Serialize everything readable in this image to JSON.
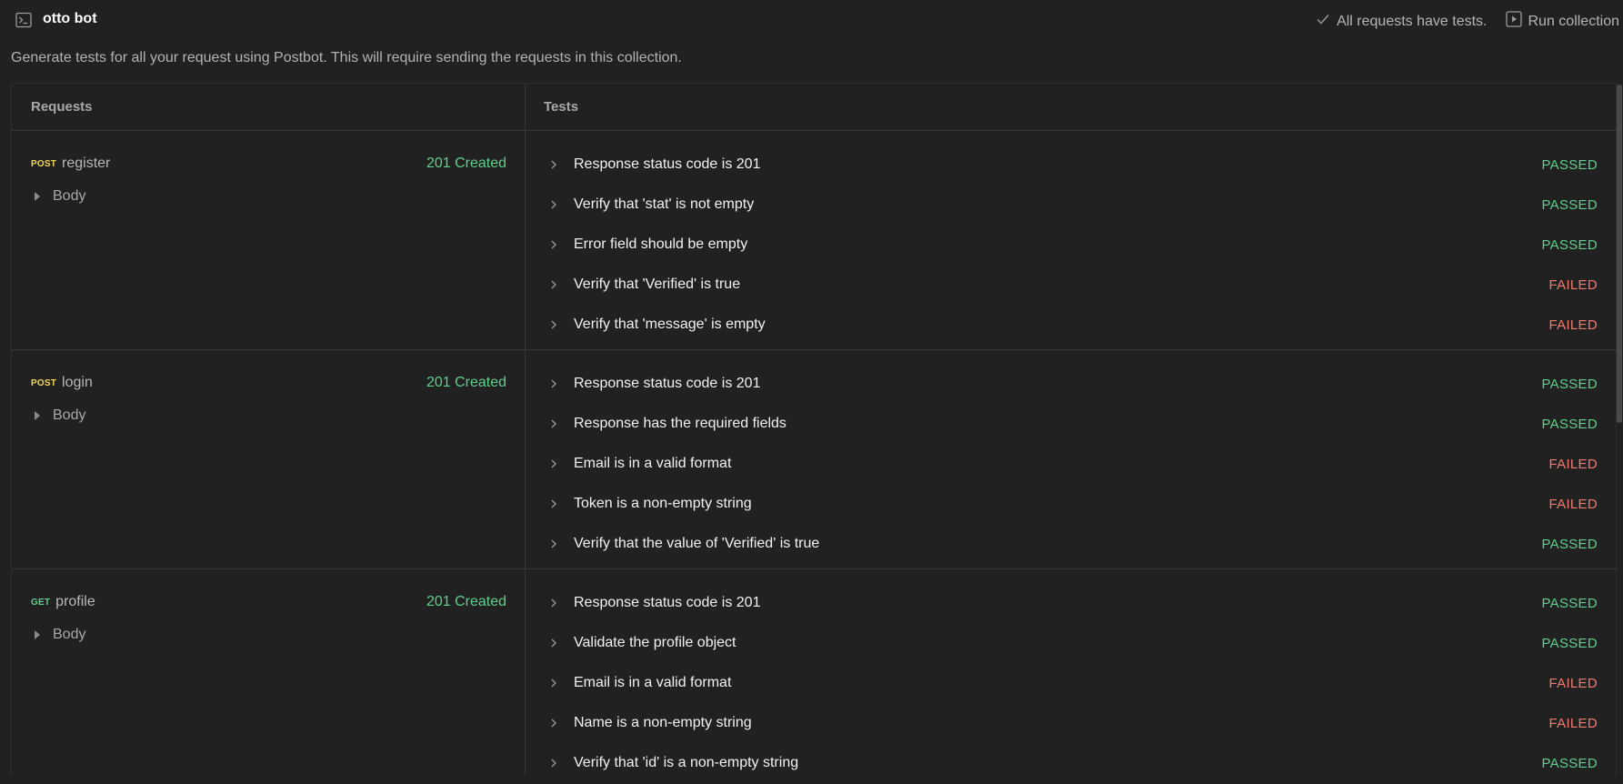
{
  "header": {
    "title": "otto bot",
    "all_tests_label": "All requests have tests.",
    "run_label": "Run collection",
    "description": "Generate tests for all your request using Postbot. This will require sending the requests in this collection."
  },
  "table": {
    "col_requests": "Requests",
    "col_tests": "Tests"
  },
  "requests": [
    {
      "method": "POST",
      "name": "register",
      "status": "201 Created",
      "body_label": "Body",
      "tests": [
        {
          "name": "Response status code is 201",
          "result": "PASSED"
        },
        {
          "name": "Verify that 'stat' is not empty",
          "result": "PASSED"
        },
        {
          "name": "Error field should be empty",
          "result": "PASSED"
        },
        {
          "name": "Verify that 'Verified' is true",
          "result": "FAILED"
        },
        {
          "name": "Verify that 'message' is empty",
          "result": "FAILED"
        }
      ]
    },
    {
      "method": "POST",
      "name": "login",
      "status": "201 Created",
      "body_label": "Body",
      "tests": [
        {
          "name": "Response status code is 201",
          "result": "PASSED"
        },
        {
          "name": "Response has the required fields",
          "result": "PASSED"
        },
        {
          "name": "Email is in a valid format",
          "result": "FAILED"
        },
        {
          "name": "Token is a non-empty string",
          "result": "FAILED"
        },
        {
          "name": "Verify that the value of 'Verified' is true",
          "result": "PASSED"
        }
      ]
    },
    {
      "method": "GET",
      "name": "profile",
      "status": "201 Created",
      "body_label": "Body",
      "tests": [
        {
          "name": "Response status code is 201",
          "result": "PASSED"
        },
        {
          "name": "Validate the profile object",
          "result": "PASSED"
        },
        {
          "name": "Email is in a valid format",
          "result": "FAILED"
        },
        {
          "name": "Name is a non-empty string",
          "result": "FAILED"
        },
        {
          "name": "Verify that 'id' is a non-empty string",
          "result": "PASSED"
        }
      ]
    }
  ],
  "colors": {
    "background": "#212121",
    "passed": "#5fcf8a",
    "failed": "#f07a6e",
    "post_method": "#f2d55a",
    "get_method": "#5fcf8a"
  }
}
